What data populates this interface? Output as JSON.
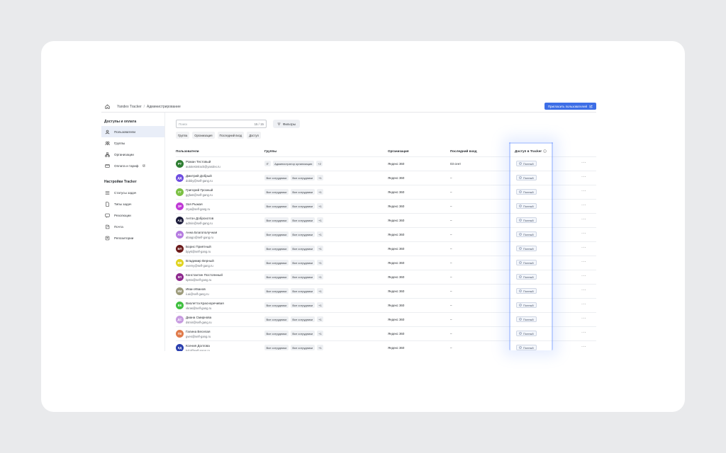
{
  "breadcrumb": {
    "app": "Yandex Tracker",
    "page": "Администрирование"
  },
  "invite_button": "Пригласить пользователей",
  "sidebar": {
    "section1_title": "Доступы и оплата",
    "section1": [
      {
        "label": "Пользователи",
        "icon": "user-icon",
        "active": true
      },
      {
        "label": "Группы",
        "icon": "group-icon"
      },
      {
        "label": "Организации",
        "icon": "org-icon"
      },
      {
        "label": "Оплата и тариф",
        "icon": "card-icon",
        "external": true
      }
    ],
    "section2_title": "Настройки Tracker",
    "section2": [
      {
        "label": "Статусы задач",
        "icon": "status-icon"
      },
      {
        "label": "Типы задач",
        "icon": "doc-icon"
      },
      {
        "label": "Резолюции",
        "icon": "flag-icon"
      },
      {
        "label": "Почта",
        "icon": "mail-icon"
      },
      {
        "label": "Репозитории",
        "icon": "repo-icon"
      }
    ]
  },
  "search": {
    "placeholder": "Поиск",
    "count": "15 / 15"
  },
  "filters_label": "Фильтры",
  "chips": [
    "Группа",
    "Организация",
    "Последний вход",
    "Доступ"
  ],
  "table": {
    "headers": {
      "users": "Пользователи",
      "groups": "Группы",
      "org": "Организация",
      "last": "Последний вход",
      "access": "Доступ в Tracker"
    },
    "rows": [
      {
        "initials": "РТ",
        "color": "#2e7d32",
        "name": "Роман Тестовый",
        "email": "autotestvtrack@yandex.ru",
        "groups": [
          "IT",
          "Администратор организации",
          "+2"
        ],
        "org": "Яндекс 360",
        "last": "03 сент",
        "access": "Полный"
      },
      {
        "initials": "ДД",
        "color": "#6d4ce0",
        "name": "Дмитрий Добрый",
        "email": "dobby@self-gang.ru",
        "groups": [
          "Все сотрудники",
          "Все сотрудники",
          "+1"
        ],
        "org": "Яндекс 360",
        "last": "–",
        "access": "Полный"
      },
      {
        "initials": "ГГ",
        "color": "#7bc043",
        "name": "Григорий Грозный",
        "email": "ggfast@self-gang.ru",
        "groups": [
          "Все сотрудники",
          "Все сотрудники",
          "+1"
        ],
        "org": "Яндекс 360",
        "last": "–",
        "access": "Полный"
      },
      {
        "initials": "ЗР",
        "color": "#c03ad6",
        "name": "Зоя Рыжая",
        "email": "zrya@self-gang.ru",
        "groups": [
          "Все сотрудники",
          "Все сотрудники",
          "+1"
        ],
        "org": "Яндекс 360",
        "last": "–",
        "access": "Полный"
      },
      {
        "initials": "АД",
        "color": "#1b1b3a",
        "name": "Антон Доброхотов",
        "email": "admin@self-gang.ru",
        "groups": [
          "Все сотрудники",
          "Все сотрудники",
          "+1"
        ],
        "org": "Яндекс 360",
        "last": "–",
        "access": "Полный"
      },
      {
        "initials": "АБ",
        "color": "#b57be0",
        "name": "Анна Благополучная",
        "email": "abiago@self-gang.ru",
        "groups": [
          "Все сотрудники",
          "Все сотрудники",
          "+1"
        ],
        "org": "Яндекс 360",
        "last": "–",
        "access": "Полный"
      },
      {
        "initials": "БП",
        "color": "#6b1a1a",
        "name": "Борис Приятный",
        "email": "bpyk@self-gang.ru",
        "groups": [
          "Все сотрудники",
          "Все сотрудники",
          "+1"
        ],
        "org": "Яндекс 360",
        "last": "–",
        "access": "Полный"
      },
      {
        "initials": "ВВ",
        "color": "#e0d31f",
        "name": "Владимир Верный",
        "email": "vverny@self-gang.ru",
        "groups": [
          "Все сотрудники",
          "Все сотрудники",
          "+1"
        ],
        "org": "Яндекс 360",
        "last": "–",
        "access": "Полный"
      },
      {
        "initials": "КП",
        "color": "#8e2a8e",
        "name": "Константин Постоянный",
        "email": "kpsto@self-gang.ru",
        "groups": [
          "Все сотрудники",
          "Все сотрудники",
          "+1"
        ],
        "org": "Яндекс 360",
        "last": "–",
        "access": "Полный"
      },
      {
        "initials": "ИИ",
        "color": "#9c9a7a",
        "name": "Иван Иванов",
        "email": "ii.ai@self-gang.ru",
        "groups": [
          "Все сотрудники",
          "Все сотрудники",
          "+1"
        ],
        "org": "Яндекс 360",
        "last": "–",
        "access": "Полный"
      },
      {
        "initials": "ВК",
        "color": "#3fbf3f",
        "name": "Виолетта Красноречивая",
        "email": "vkras@self-gang.ru",
        "groups": [
          "Все сотрудники",
          "Все сотрудники",
          "+1"
        ],
        "org": "Яндекс 360",
        "last": "–",
        "access": "Полный"
      },
      {
        "initials": "ДС",
        "color": "#c79be0",
        "name": "Диана Смирнова",
        "email": "dsmir@self-gang.ru",
        "groups": [
          "Все сотрудники",
          "Все сотрудники",
          "+1"
        ],
        "org": "Яндекс 360",
        "last": "–",
        "access": "Полный"
      },
      {
        "initials": "ГВ",
        "color": "#e07a4a",
        "name": "Галина Веселая",
        "email": "gves@self-gang.ru",
        "groups": [
          "Все сотрудники",
          "Все сотрудники",
          "+1"
        ],
        "org": "Яндекс 360",
        "last": "–",
        "access": "Полный"
      },
      {
        "initials": "КД",
        "color": "#2a3fae",
        "name": "Ксения Долгова",
        "email": "kdol@self-gang.ru",
        "groups": [
          "Все сотрудники",
          "Все сотрудники",
          "+1"
        ],
        "org": "Яндекс 360",
        "last": "–",
        "access": "Полный"
      }
    ]
  }
}
